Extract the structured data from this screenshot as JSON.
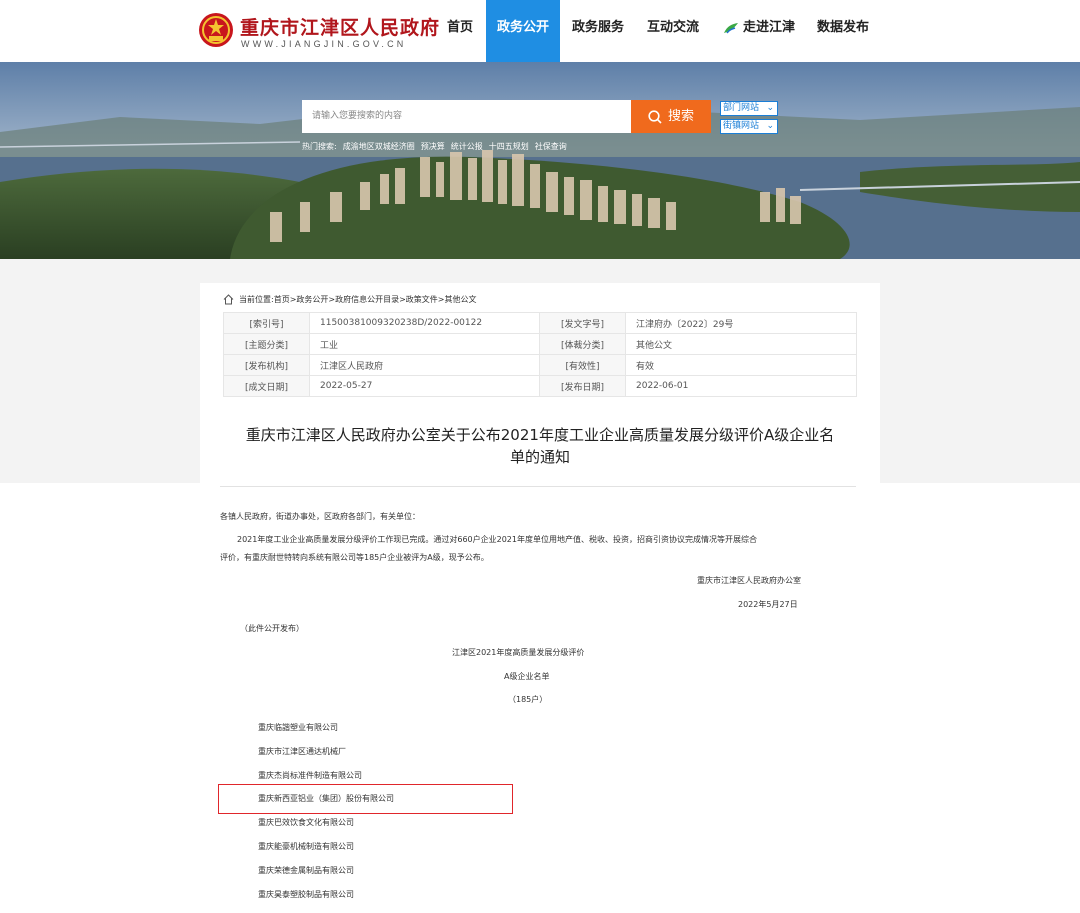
{
  "header": {
    "site_title": "重庆市江津区人民政府",
    "site_domain": "WWW.JIANGJIN.GOV.CN",
    "nav": [
      {
        "label": "首页"
      },
      {
        "label": "政务公开",
        "active": true
      },
      {
        "label": "政务服务"
      },
      {
        "label": "互动交流"
      },
      {
        "label": "走进江津"
      },
      {
        "label": "数据发布"
      }
    ]
  },
  "search": {
    "placeholder": "请输入您要搜索的内容",
    "button_label": "搜索",
    "dept_select": "部门网站",
    "street_select": "街镇网站",
    "hot_label": "热门搜索:",
    "hot_terms": [
      "成渝地区双城经济圈",
      "预决算",
      "统计公报",
      "十四五规划",
      "社保查询"
    ]
  },
  "breadcrumb": {
    "label": "当前位置:",
    "path": "首页>政务公开>政府信息公开目录>政策文件>其他公文"
  },
  "meta": {
    "rows": [
      {
        "k1": "[索引号]",
        "v1": "11500381009320238D/2022-00122",
        "k2": "[发文字号]",
        "v2": "江津府办〔2022〕29号"
      },
      {
        "k1": "[主题分类]",
        "v1": "工业",
        "k2": "[体裁分类]",
        "v2": "其他公文"
      },
      {
        "k1": "[发布机构]",
        "v1": "江津区人民政府",
        "k2": "[有效性]",
        "v2": "有效"
      },
      {
        "k1": "[成文日期]",
        "v1": "2022-05-27",
        "k2": "[发布日期]",
        "v2": "2022-06-01"
      }
    ]
  },
  "document": {
    "title_line1": "重庆市江津区人民政府办公室关于公布2021年度工业企业高质量发展分级评价A级企业名",
    "title_line2": "单的通知",
    "salutation": "各镇人民政府，街道办事处，区政府各部门，有关单位：",
    "para1_line1": "2021年度工业企业高质量发展分级评价工作现已完成。通过对660户企业2021年度单位用地产值、税收、投资，招商引资协议完成情况等开展综合",
    "para1_line2": "评价，有重庆耐世特转向系统有限公司等185户企业被评为A级，现予公布。",
    "signer": "重庆市江津区人民政府办公室",
    "sign_date": "2022年5月27日",
    "publish_note": "（此件公开发布）",
    "list_title1": "江津区2021年度高质量发展分级评价",
    "list_title2": "A级企业名单",
    "list_count": "（185户）"
  },
  "companies": [
    "重庆临諧塑业有限公司",
    "重庆市江津区通达机械厂",
    "重庆杰尚标准件制造有限公司",
    "重庆新西亚铝业（集团）股份有限公司",
    "重庆巴效饮食文化有限公司",
    "重庆能豪机械制造有限公司",
    "重庆荣德金属制品有限公司",
    "重庆昊泰塑胶制品有限公司"
  ],
  "colors": {
    "brand_red": "#b1161c",
    "nav_active": "#1f8ee3",
    "search_orange": "#f06a1d",
    "highlight_red": "#e0262b"
  }
}
